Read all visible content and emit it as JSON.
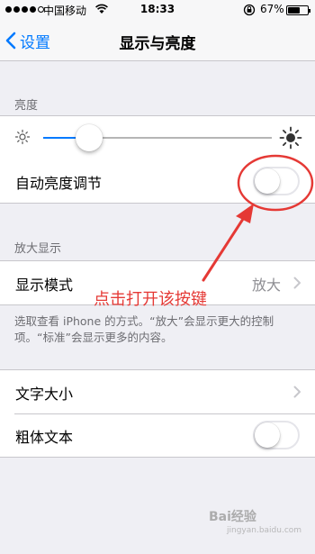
{
  "status_bar": {
    "carrier": "中国移动",
    "time": "18:33",
    "battery": "67%",
    "battery_level": 0.67,
    "signal_icon": "signal-dots-icon",
    "wifi_icon": "wifi-icon",
    "lock_icon": "rotation-lock-icon"
  },
  "nav": {
    "back_label": "设置",
    "title": "显示与亮度"
  },
  "brightness": {
    "header": "亮度",
    "level": 0.2,
    "auto_label": "自动亮度调节",
    "auto_on": false
  },
  "zoom": {
    "header": "放大显示",
    "mode_label": "显示模式",
    "mode_value": "放大",
    "note": "选取查看 iPhone 的方式。“放大”会显示更大的控制项。“标准”会显示更多的内容。"
  },
  "text": {
    "size_label": "文字大小",
    "bold_label": "粗体文本",
    "bold_on": false
  },
  "annotation": {
    "text": "点击打开该按键",
    "color": "#e53935"
  },
  "colors": {
    "accent": "#007aff",
    "background": "#efeff4"
  },
  "watermark": {
    "brand": "Bai经验",
    "sub": "jingyan.baidu.com"
  }
}
